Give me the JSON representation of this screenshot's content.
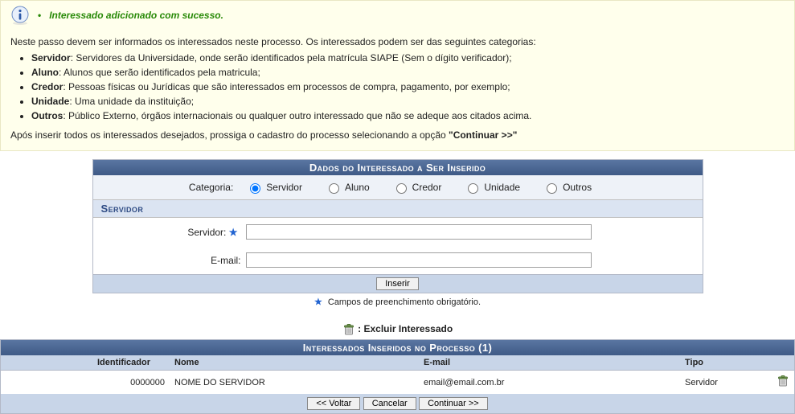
{
  "success": {
    "message": "Interessado adicionado com sucesso."
  },
  "help": {
    "intro": "Neste passo devem ser informados os interessados neste processo. Os interessados podem ser das seguintes categorias:",
    "items": [
      {
        "label": "Servidor",
        "desc": ": Servidores da Universidade, onde serão identificados pela matrícula SIAPE (Sem o dígito verificador);"
      },
      {
        "label": "Aluno",
        "desc": ": Alunos que serão identificados pela matricula;"
      },
      {
        "label": "Credor",
        "desc": ": Pessoas físicas ou Jurídicas que são interessados em processos de compra, pagamento, por exemplo;"
      },
      {
        "label": "Unidade",
        "desc": ": Uma unidade da instituição;"
      },
      {
        "label": "Outros",
        "desc": ": Público Externo, órgãos internacionais ou qualquer outro interessado que não se adeque aos citados acima."
      }
    ],
    "after_prefix": "Após inserir todos os interessados desejados, prossiga o cadastro do processo selecionando a opção ",
    "after_bold": "\"Continuar >>\""
  },
  "form": {
    "header": "Dados do Interessado a Ser Inserido",
    "categoria_label": "Categoria:",
    "options": {
      "servidor": "Servidor",
      "aluno": "Aluno",
      "credor": "Credor",
      "unidade": "Unidade",
      "outros": "Outros"
    },
    "subsection": "Servidor",
    "fields": {
      "servidor_label": "Servidor:",
      "servidor_value": "",
      "email_label": "E-mail:",
      "email_value": ""
    },
    "submit_label": "Inserir",
    "required_star": "★",
    "required_note": "Campos de preenchimento obrigatório."
  },
  "legend": {
    "text": ": Excluir Interessado"
  },
  "table": {
    "header": "Interessados Inseridos no Processo (1)",
    "columns": {
      "id": "Identificador",
      "nome": "Nome",
      "email": "E-mail",
      "tipo": "Tipo"
    },
    "rows": [
      {
        "id": "0000000",
        "nome": "NOME DO SERVIDOR",
        "email": "email@email.com.br",
        "tipo": "Servidor"
      }
    ]
  },
  "nav": {
    "back": "<< Voltar",
    "cancel": "Cancelar",
    "continue": "Continuar >>"
  }
}
